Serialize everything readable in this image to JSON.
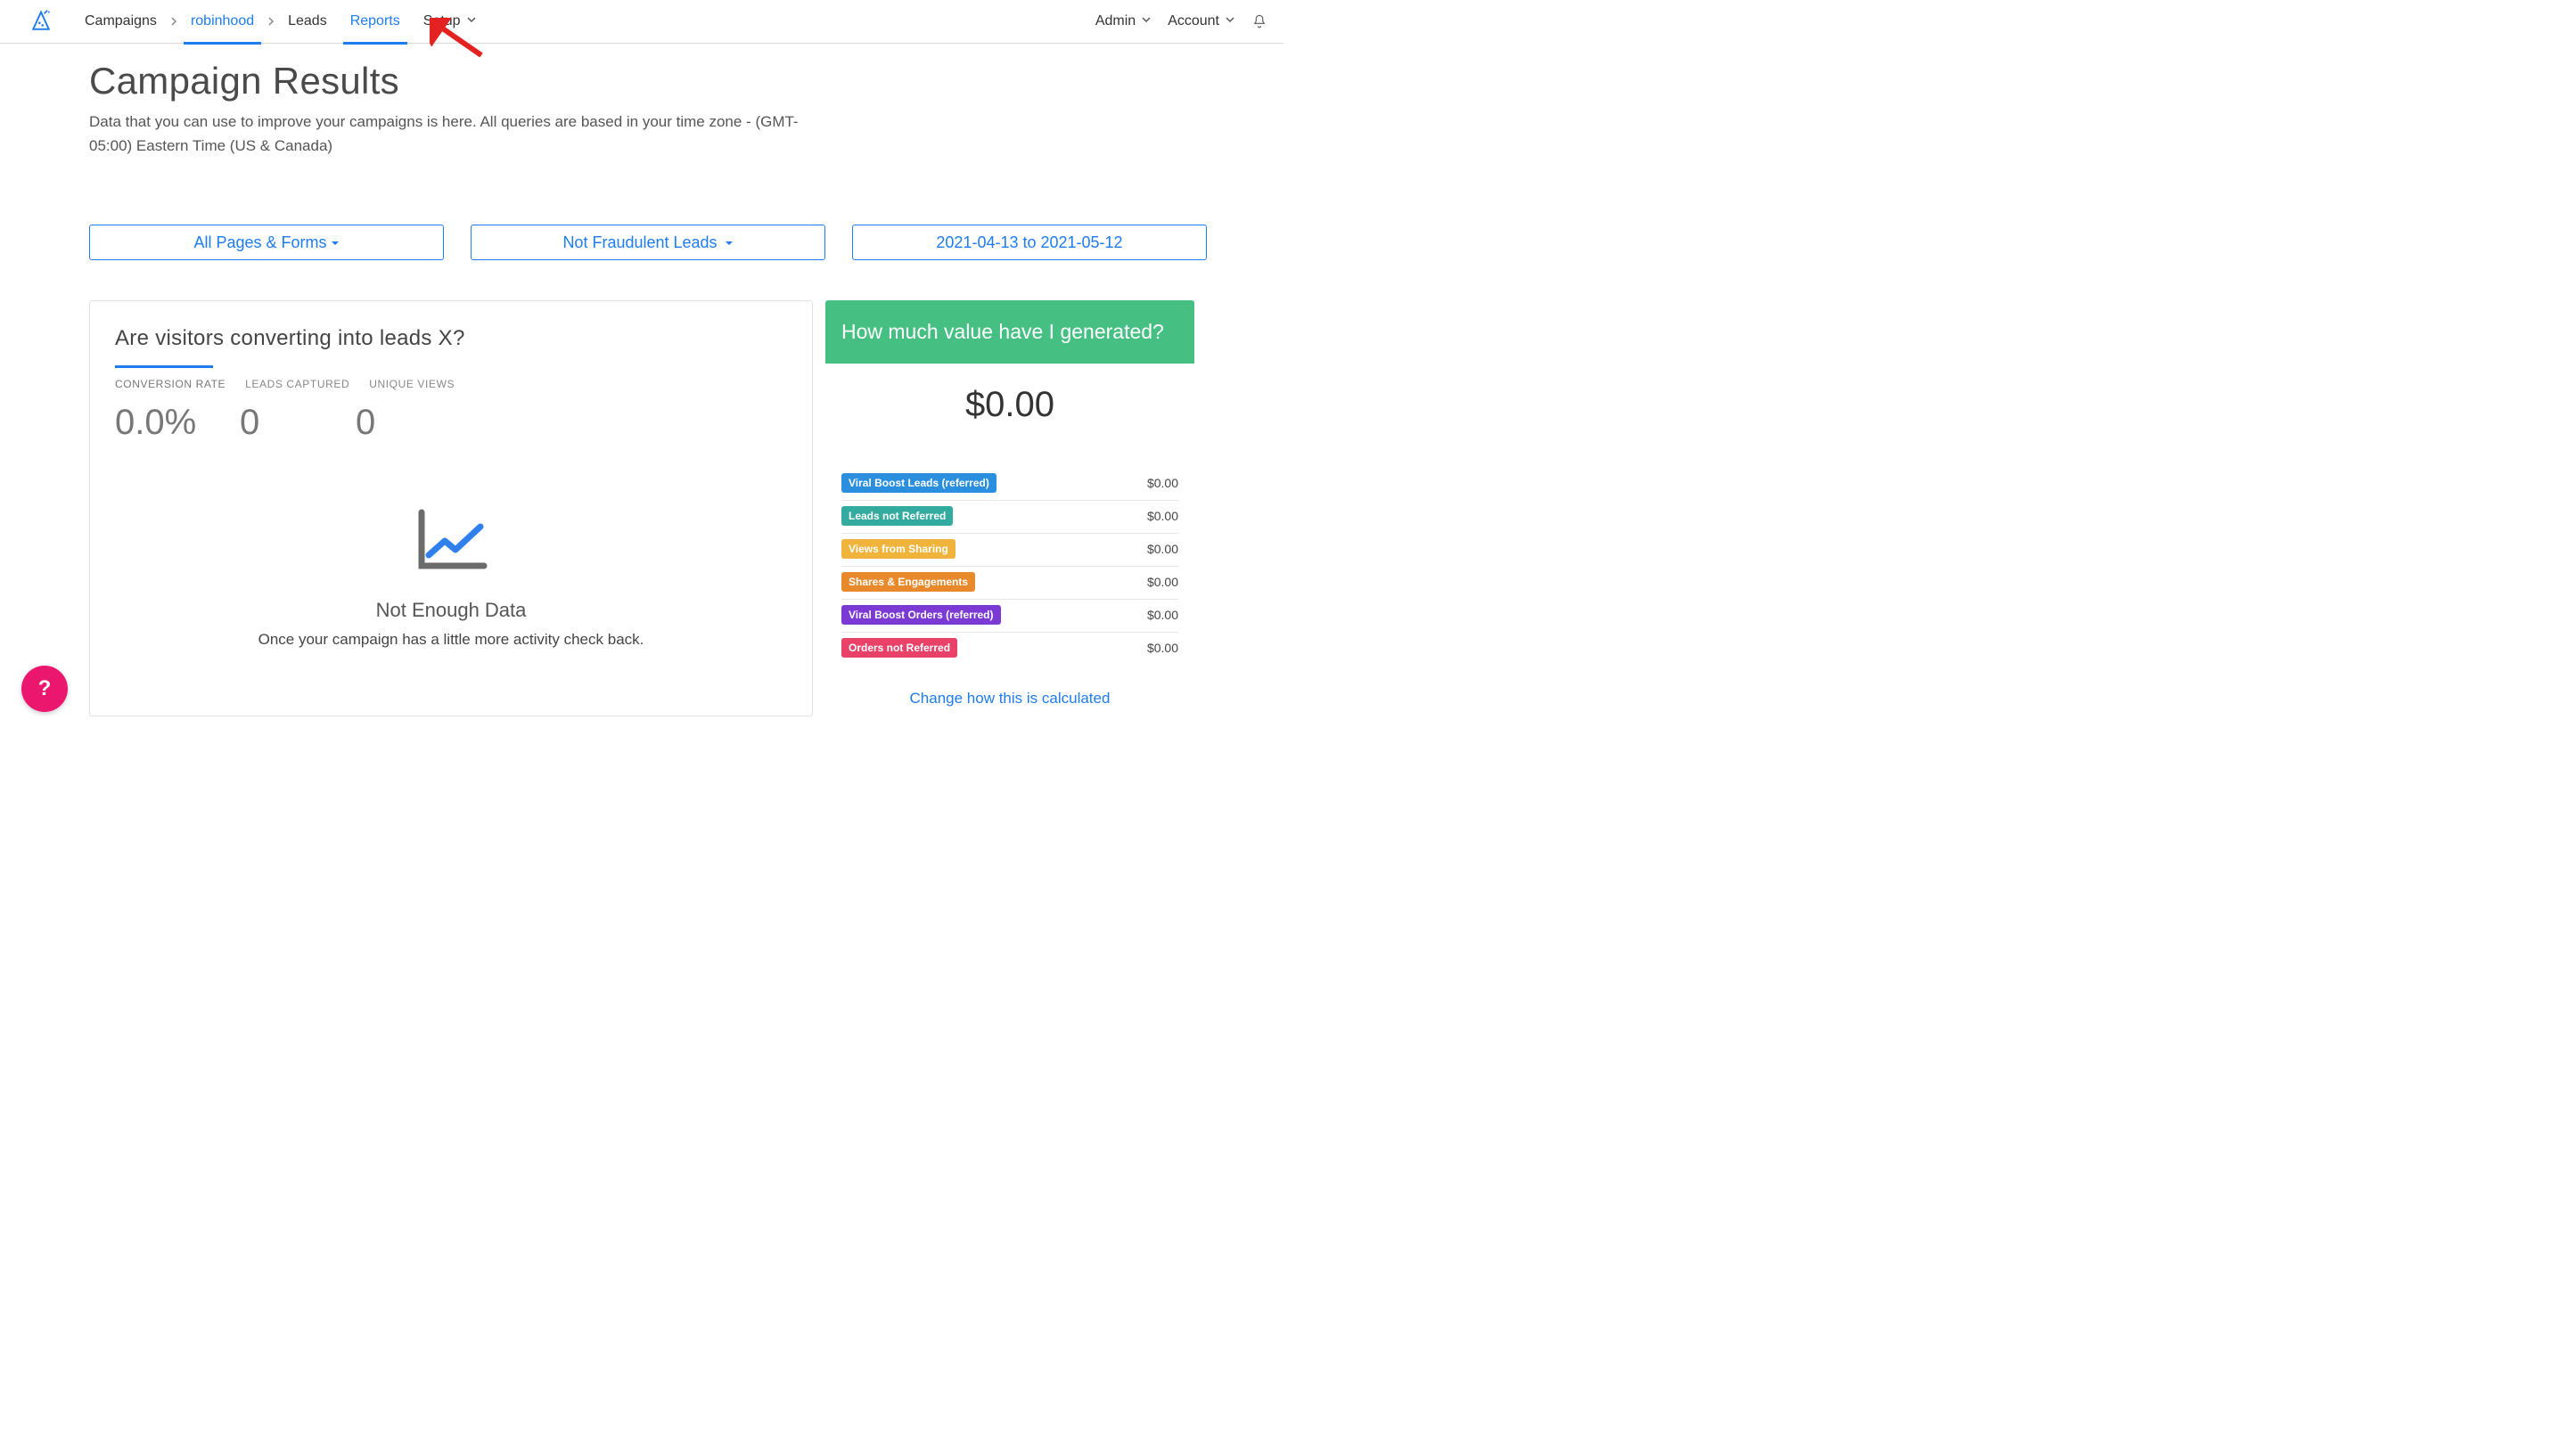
{
  "nav": {
    "campaigns": "Campaigns",
    "campaign_name": "robinhood",
    "leads": "Leads",
    "reports": "Reports",
    "setup": "Setup",
    "admin": "Admin",
    "account": "Account"
  },
  "page": {
    "title": "Campaign Results",
    "subtitle": "Data that you can use to improve your campaigns is here. All queries are based in your time zone - (GMT-05:00) Eastern Time (US & Canada)"
  },
  "filters": {
    "pages": "All Pages & Forms",
    "fraud": "Not Fraudulent Leads",
    "dates": "2021-04-13 to 2021-05-12"
  },
  "conversion_panel": {
    "heading": "Are visitors converting into leads X?",
    "tabs": {
      "conversion_rate": "CONVERSION RATE",
      "leads_captured": "LEADS CAPTURED",
      "unique_views": "UNIQUE VIEWS"
    },
    "values": {
      "conversion_rate": "0.0%",
      "leads_captured": "0",
      "unique_views": "0"
    },
    "no_data_title": "Not Enough Data",
    "no_data_text": "Once your campaign has a little more activity check back."
  },
  "value_panel": {
    "heading": "How much value have I generated?",
    "total": "$0.00",
    "rows": [
      {
        "label": "Viral Boost Leads (referred)",
        "color": "#2b8fe0",
        "amount": "$0.00"
      },
      {
        "label": "Leads not Referred",
        "color": "#34ab9f",
        "amount": "$0.00"
      },
      {
        "label": "Views from Sharing",
        "color": "#f0b43c",
        "amount": "$0.00"
      },
      {
        "label": "Shares & Engagements",
        "color": "#e88a2b",
        "amount": "$0.00"
      },
      {
        "label": "Viral Boost Orders (referred)",
        "color": "#7a3ad3",
        "amount": "$0.00"
      },
      {
        "label": "Orders not Referred",
        "color": "#e94168",
        "amount": "$0.00"
      }
    ],
    "calc_link": "Change how this is calculated"
  },
  "help_fab": "?"
}
